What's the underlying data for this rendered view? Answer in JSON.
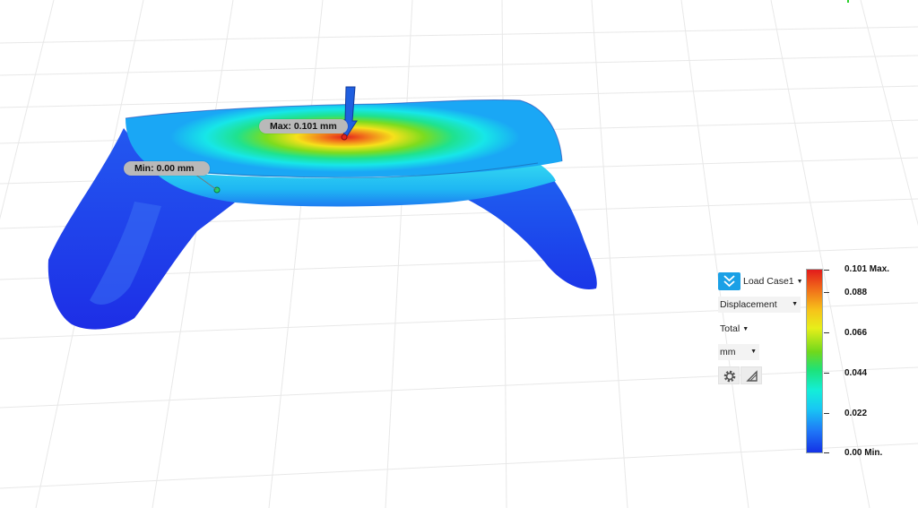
{
  "probes": {
    "max_label": "Max: 0.101 mm",
    "min_label": "Min: 0.00 mm"
  },
  "controls": {
    "load_case": "Load Case1",
    "result_type": "Displacement",
    "component": "Total",
    "unit": "mm"
  },
  "legend": {
    "labels": [
      "0.101 Max.",
      "0.088",
      "0.066",
      "0.044",
      "0.022",
      "0.00 Min."
    ]
  },
  "icons": {
    "load_case": "load-case-chevron-icon",
    "settings": "gear-icon",
    "triangle": "triangle-icon"
  },
  "colors": {
    "accent": "#1aa0e6",
    "max": "#e21b1b",
    "min": "#1431e6"
  }
}
